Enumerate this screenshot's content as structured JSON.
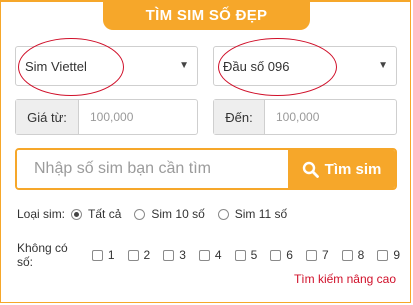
{
  "header": {
    "title": "TÌM SIM SỐ ĐẸP"
  },
  "filters": {
    "network": {
      "selected": "Sim Viettel"
    },
    "prefix": {
      "selected": "Đầu số 096"
    },
    "price_from": {
      "label": "Giá từ:",
      "value": "100,000"
    },
    "price_to": {
      "label": "Đến:",
      "value": "100,000"
    }
  },
  "search": {
    "placeholder": "Nhập số sim bạn cần tìm",
    "button_label": "Tìm sim"
  },
  "sim_type": {
    "label": "Loại sim:",
    "options": [
      {
        "label": "Tất cả",
        "checked": true
      },
      {
        "label": "Sim 10 số",
        "checked": false
      },
      {
        "label": "Sim 11 số",
        "checked": false
      }
    ]
  },
  "exclude_digits": {
    "label": "Không có số:",
    "digits": [
      "1",
      "2",
      "3",
      "4",
      "5",
      "6",
      "7",
      "8",
      "9"
    ]
  },
  "advanced_link": "Tìm kiếm nâng cao"
}
